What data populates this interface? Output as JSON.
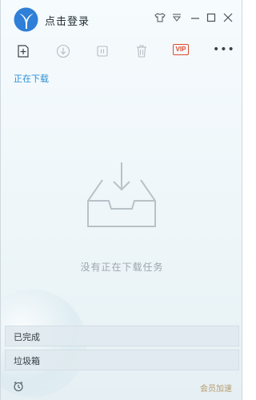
{
  "header": {
    "login_label": "点击登录",
    "icons": [
      "skin-icon",
      "dropdown-icon",
      "minimize-icon",
      "maximize-icon",
      "close-icon"
    ]
  },
  "toolbar": {
    "vip_label": "VIP",
    "more_label": "•••",
    "icons": [
      "new-task-icon",
      "download-icon",
      "pause-icon",
      "trash-icon",
      "vip-icon",
      "more-icon"
    ]
  },
  "main": {
    "section_title": "正在下载",
    "empty_message": "没有正在下载任务"
  },
  "sidebar_bottom": {
    "items": [
      {
        "label": "已完成"
      },
      {
        "label": "垃圾箱"
      }
    ]
  },
  "footer": {
    "member_label": "会员加速"
  },
  "colors": {
    "accent": "#2b8fd6",
    "vip": "#e04a2f",
    "muted_text": "#9aa6ad"
  }
}
